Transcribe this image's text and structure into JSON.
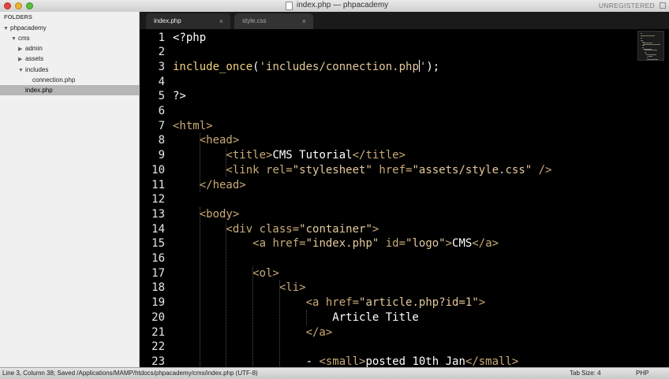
{
  "window": {
    "title": "index.php — phpacademy",
    "unregistered": "UNREGISTERED"
  },
  "sidebar": {
    "header": "FOLDERS",
    "items": [
      {
        "label": "phpacademy",
        "expanded": true
      },
      {
        "label": "cms",
        "expanded": true
      },
      {
        "label": "admin",
        "expanded": false
      },
      {
        "label": "assets",
        "expanded": false
      },
      {
        "label": "includes",
        "expanded": true
      },
      {
        "label": "connection.php"
      },
      {
        "label": "index.php",
        "selected": true
      }
    ]
  },
  "tabs": [
    {
      "label": "index.php",
      "active": true,
      "close": "×"
    },
    {
      "label": "style.css",
      "active": false,
      "close": "×"
    }
  ],
  "editor": {
    "line_numbers": [
      "1",
      "2",
      "3",
      "4",
      "5",
      "6",
      "7",
      "8",
      "9",
      "10",
      "11",
      "12",
      "13",
      "14",
      "15",
      "16",
      "17",
      "18",
      "19",
      "20",
      "21",
      "22",
      "23"
    ],
    "lines": [
      [
        [
          "<?php",
          "#ffffff"
        ]
      ],
      [],
      [
        [
          "include_once",
          "#f2d27a"
        ],
        [
          "(",
          "#ffffff"
        ],
        [
          "'includes/connection.php",
          "#e3c99a"
        ],
        [
          "|cursor|",
          ""
        ],
        [
          "'",
          "#e3c99a"
        ],
        [
          ");",
          "#ffffff"
        ]
      ],
      [],
      [
        [
          "?>",
          "#ffffff"
        ]
      ],
      [],
      [
        [
          "<html>",
          "#c9ab77"
        ]
      ],
      [
        [
          "    <head>",
          "#c9ab77"
        ]
      ],
      [
        [
          "        <title>",
          "#c9ab77"
        ],
        [
          "CMS Tutorial",
          "#ffffff"
        ],
        [
          "</title>",
          "#c9ab77"
        ]
      ],
      [
        [
          "        <link ",
          "#c9ab77"
        ],
        [
          "rel=",
          "#c9ab77"
        ],
        [
          "\"stylesheet\"",
          "#e3c99a"
        ],
        [
          " href=",
          "#c9ab77"
        ],
        [
          "\"assets/style.css\"",
          "#e3c99a"
        ],
        [
          " />",
          "#c9ab77"
        ]
      ],
      [
        [
          "    </head>",
          "#c9ab77"
        ]
      ],
      [],
      [
        [
          "    <body>",
          "#c9ab77"
        ]
      ],
      [
        [
          "        <div ",
          "#c9ab77"
        ],
        [
          "class=",
          "#c9ab77"
        ],
        [
          "\"container\"",
          "#e3c99a"
        ],
        [
          ">",
          "#c9ab77"
        ]
      ],
      [
        [
          "            <a ",
          "#c9ab77"
        ],
        [
          "href=",
          "#c9ab77"
        ],
        [
          "\"index.php\"",
          "#e3c99a"
        ],
        [
          " id=",
          "#c9ab77"
        ],
        [
          "\"logo\"",
          "#e3c99a"
        ],
        [
          ">",
          "#c9ab77"
        ],
        [
          "CMS",
          "#ffffff"
        ],
        [
          "</a>",
          "#c9ab77"
        ]
      ],
      [],
      [
        [
          "            <ol>",
          "#c9ab77"
        ]
      ],
      [
        [
          "                <li>",
          "#c9ab77"
        ]
      ],
      [
        [
          "                    <a ",
          "#c9ab77"
        ],
        [
          "href=",
          "#c9ab77"
        ],
        [
          "\"article.php?id=1\"",
          "#e3c99a"
        ],
        [
          ">",
          "#c9ab77"
        ]
      ],
      [
        [
          "                        Article Title",
          "#ffffff"
        ]
      ],
      [
        [
          "                    </a>",
          "#c9ab77"
        ]
      ],
      [],
      [
        [
          "                    - ",
          "#ffffff"
        ],
        [
          "<small>",
          "#c9ab77"
        ],
        [
          "posted 10th Jan",
          "#ffffff"
        ],
        [
          "</small>",
          "#c9ab77"
        ]
      ]
    ]
  },
  "status": {
    "left": "Line 3, Column 38; Saved /Applications/MAMP/htdocs/phpacademy/cms/index.php (UTF-8)",
    "tab_size": "Tab Size: 4",
    "syntax": "PHP"
  }
}
